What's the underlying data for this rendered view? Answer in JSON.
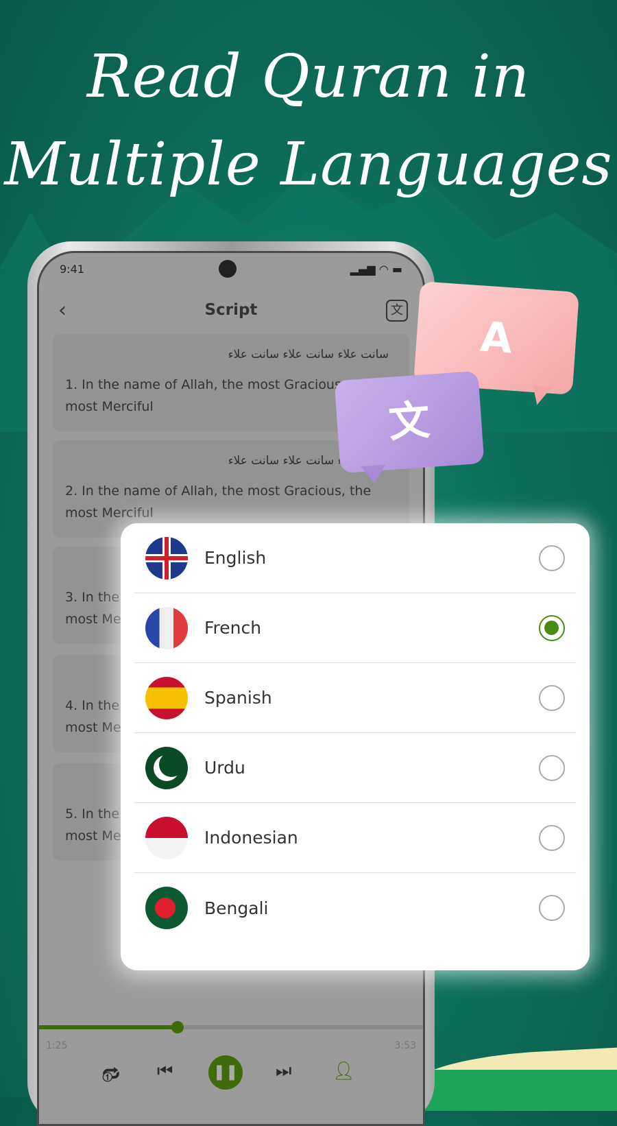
{
  "headline": {
    "line1": "Read Quran in",
    "line2": "Multiple Languages"
  },
  "phone": {
    "status": {
      "time": "9:41",
      "signal_icon": "signal-icon",
      "wifi_icon": "wifi-icon",
      "battery_icon": "battery-icon"
    },
    "nav": {
      "back_icon": "chevron-left-icon",
      "title": "Script",
      "translate_icon": "translate-icon"
    },
    "verses": [
      {
        "arabic": "سانت علاء سانت علاء سانت علاء",
        "text": "1. In the name of Allah, the most Gracious, the most Merciful"
      },
      {
        "arabic": "سانت علاء سانت علاء سانت علاء",
        "text": "2. In the name of Allah, the most Gracious, the most Merciful"
      },
      {
        "arabic": "",
        "text": "3. In the name of Allah, the most Gracious, the most Merciful"
      },
      {
        "arabic": "",
        "text": "4. In the name of Allah, the most Gracious, the most Merciful"
      },
      {
        "arabic": "",
        "text": "5. In the name of Allah, the most Gracious, the most Merciful"
      }
    ],
    "player": {
      "elapsed": "1:25",
      "total": "3:53",
      "progress_percent": 36,
      "accent": "#3f6b0b"
    }
  },
  "bubbles": {
    "latin": "A",
    "cjk": "文"
  },
  "languages": [
    {
      "name": "English",
      "selected": false
    },
    {
      "name": "French",
      "selected": true
    },
    {
      "name": "Spanish",
      "selected": false
    },
    {
      "name": "Urdu",
      "selected": false
    },
    {
      "name": "Indonesian",
      "selected": false
    },
    {
      "name": "Bengali",
      "selected": false
    }
  ],
  "colors": {
    "background": "#0c6c58",
    "radio_selected": "#4a8c12"
  }
}
